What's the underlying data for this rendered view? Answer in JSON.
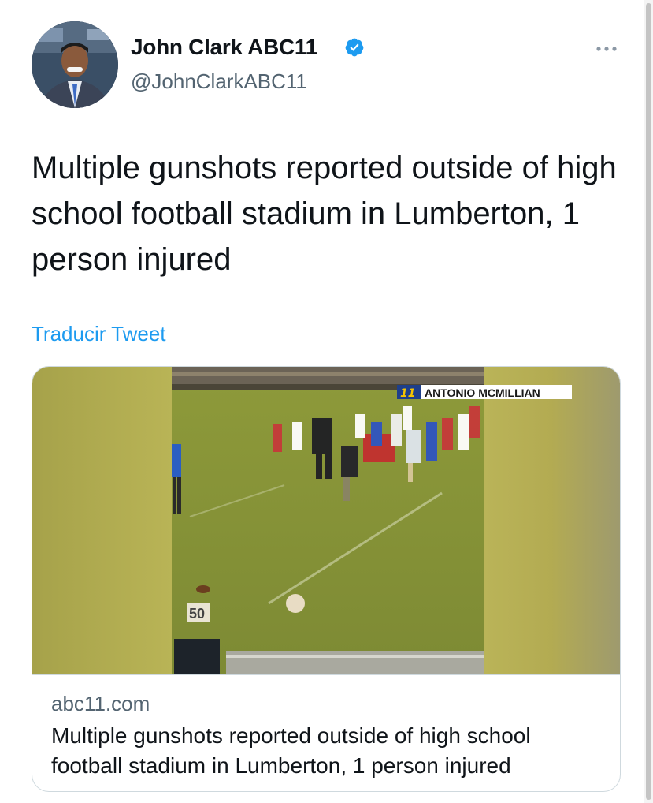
{
  "tweet": {
    "author": {
      "name": "John Clark ABC11",
      "handle": "@JohnClarkABC11",
      "verified": true
    },
    "text": "Multiple gunshots reported outside of high school football stadium in Lumberton, 1 person injured",
    "translate_label": "Traducir Tweet",
    "more_icon": "more-horizontal-icon",
    "verified_icon": "verified-badge-icon"
  },
  "card": {
    "domain": "abc11.com",
    "title": "Multiple gunshots reported outside of high school football stadium in Lumberton, 1 person injured",
    "media": {
      "chyron_logo": "11",
      "chyron_text": "ANTONIO MCMILLIAN",
      "yard_marker": "50"
    }
  },
  "colors": {
    "link": "#1d9bf0",
    "verified": "#1d9bf0",
    "text_primary": "#0f1419",
    "text_secondary": "#536471",
    "border": "#cfd9de"
  }
}
